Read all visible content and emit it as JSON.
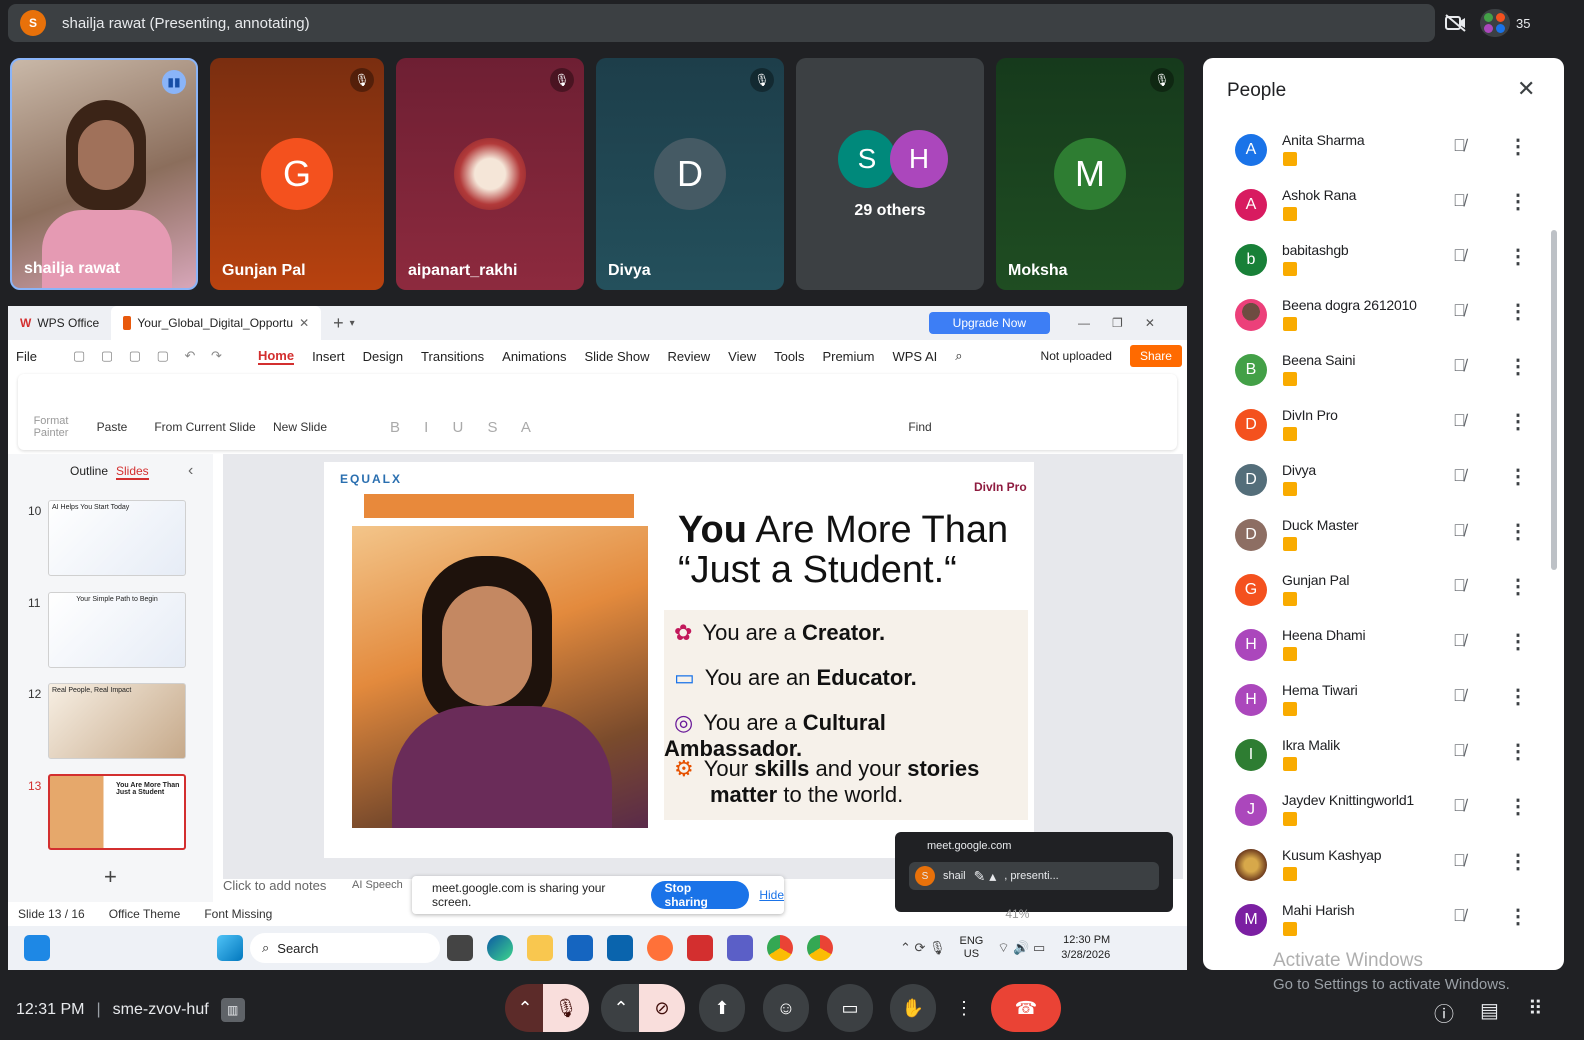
{
  "presenter": {
    "avatar": "S",
    "label": "shailja rawat (Presenting, annotating)"
  },
  "participant_count": "35",
  "tiles": [
    {
      "name": "shailja rawat",
      "avatar": ""
    },
    {
      "name": "Gunjan Pal",
      "avatar": "G",
      "color": "#f4511e"
    },
    {
      "name": "aipanart_rakhi",
      "avatar": ""
    },
    {
      "name": "Divya",
      "avatar": "D",
      "color": "#455a64"
    },
    {
      "name": "",
      "avatar1": "S",
      "avatar2": "H",
      "others": "29 others"
    },
    {
      "name": "Moksha",
      "avatar": "M",
      "color": "#2e7d32"
    }
  ],
  "wps": {
    "tab1": "WPS Office",
    "tab2": "Your_Global_Digital_Opportu",
    "upgrade": "Upgrade Now",
    "menu": [
      "File",
      "Home",
      "Insert",
      "Design",
      "Transitions",
      "Animations",
      "Slide Show",
      "Review",
      "View",
      "Tools",
      "Premium",
      "WPS AI"
    ],
    "not_uploaded": "Not uploaded",
    "share": "Share",
    "ribbon": {
      "format_painter": "Format Painter",
      "paste": "Paste",
      "from_current": "From Current Slide",
      "new_slide": "New Slide",
      "find": "Find"
    },
    "sidebar": {
      "outline": "Outline",
      "slides": "Slides",
      "nums": [
        "10",
        "11",
        "12",
        "13"
      ],
      "thumb_titles": [
        "AI Helps You Start Today",
        "Your Simple Path to Begin",
        "Real People, Real Impact",
        "You Are More Than Just a Student"
      ]
    },
    "slide": {
      "logo_left": "EQUALX",
      "logo_right": "DivIn Pro",
      "title_bold": "You",
      "title_rest": " Are More Than",
      "title_line2": "“Just a Student.“",
      "bullets": [
        {
          "pre": "You are a ",
          "bold": "Creator.",
          "post": ""
        },
        {
          "pre": "You are an ",
          "bold": "Educator.",
          "post": ""
        },
        {
          "pre": "You are a ",
          "bold": "Cultural Ambassador.",
          "post": ""
        },
        {
          "pre": "Your ",
          "bold": "skills",
          "post": " and your "
        }
      ],
      "last_bold": "stories",
      "last_line2_bold": "matter",
      "last_line2_rest": " to the world."
    },
    "notes_placeholder": "Click to add notes",
    "ai_speech": "AI Speech",
    "status": {
      "slide": "Slide 13 / 16",
      "theme": "Office Theme",
      "font": "Font Missing",
      "zoom": "41%"
    },
    "sharing": {
      "text": "meet.google.com is sharing your screen.",
      "stop": "Stop sharing",
      "hide": "Hide"
    },
    "mini": {
      "url": "meet.google.com",
      "avatar": "S",
      "name": "shail",
      "rest": ", presenti..."
    },
    "taskbar": {
      "search": "Search",
      "lang1": "ENG",
      "lang2": "US",
      "time": "12:30 PM",
      "date": "3/28/2026"
    }
  },
  "people": {
    "title": "People",
    "list": [
      {
        "name": "Anita Sharma",
        "avatar": "A",
        "color": "#1a73e8"
      },
      {
        "name": "Ashok Rana",
        "avatar": "A",
        "color": "#d81b60"
      },
      {
        "name": "babitashgb",
        "avatar": "b",
        "color": "#188038"
      },
      {
        "name": "Beena dogra 2612010",
        "avatar": "",
        "color": "#ec407a"
      },
      {
        "name": "Beena Saini",
        "avatar": "B",
        "color": "#43a047"
      },
      {
        "name": "DivIn Pro",
        "avatar": "D",
        "color": "#f4511e"
      },
      {
        "name": "Divya",
        "avatar": "D",
        "color": "#546e7a"
      },
      {
        "name": "Duck Master",
        "avatar": "D",
        "color": "#8d6e63"
      },
      {
        "name": "Gunjan Pal",
        "avatar": "G",
        "color": "#f4511e"
      },
      {
        "name": "Heena Dhami",
        "avatar": "H",
        "color": "#ab47bc"
      },
      {
        "name": "Hema Tiwari",
        "avatar": "H",
        "color": "#ab47bc"
      },
      {
        "name": "Ikra Malik",
        "avatar": "I",
        "color": "#2e7d32"
      },
      {
        "name": "Jaydev Knittingworld1",
        "avatar": "J",
        "color": "#ab47bc"
      },
      {
        "name": "Kusum Kashyap",
        "avatar": "",
        "color": "#a1887f"
      },
      {
        "name": "Mahi Harish",
        "avatar": "M",
        "color": "#7b1fa2"
      }
    ],
    "watermark1": "Activate Windows",
    "watermark2": "Go to Settings to activate Windows."
  },
  "bottom": {
    "time": "12:31 PM",
    "meeting_code": "sme-zvov-huf"
  }
}
